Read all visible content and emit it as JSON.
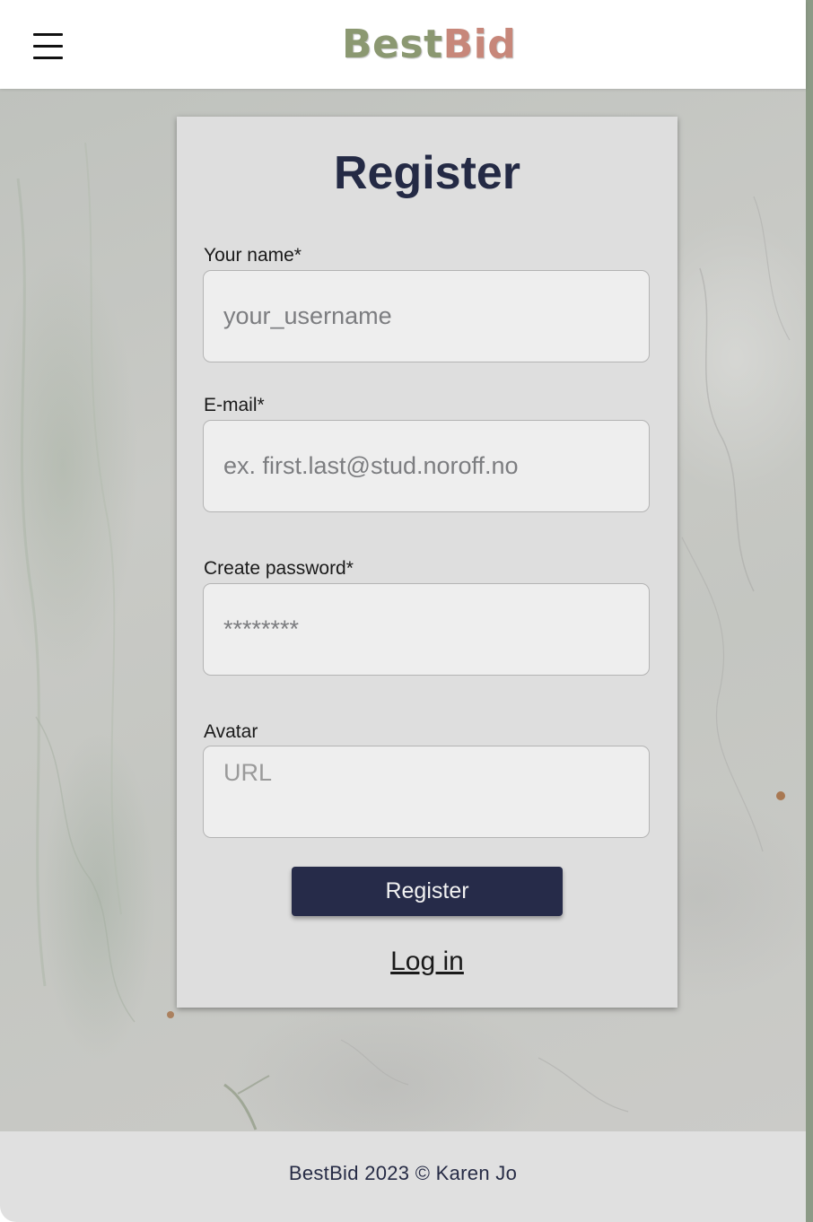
{
  "header": {
    "logo_part1": "Best",
    "logo_part2": "Bid",
    "menu_icon": "hamburger-menu-icon"
  },
  "form": {
    "title": "Register",
    "fields": [
      {
        "label": "Your name*",
        "placeholder": "your_username",
        "value": ""
      },
      {
        "label": "E-mail*",
        "placeholder": "ex. first.last@stud.noroff.no",
        "value": ""
      },
      {
        "label": "Create password*",
        "placeholder": "********",
        "value": ""
      },
      {
        "label": "Avatar",
        "placeholder": "URL",
        "value": ""
      }
    ],
    "submit_label": "Register",
    "login_link": "Log in"
  },
  "footer": {
    "text": "BestBid 2023 © Karen Jo"
  },
  "colors": {
    "primary": "#262b49",
    "logo_green": "#8b9871",
    "logo_rose": "#c7877a",
    "card_bg": "#dedede",
    "footer_bg": "#e0e0e0"
  }
}
